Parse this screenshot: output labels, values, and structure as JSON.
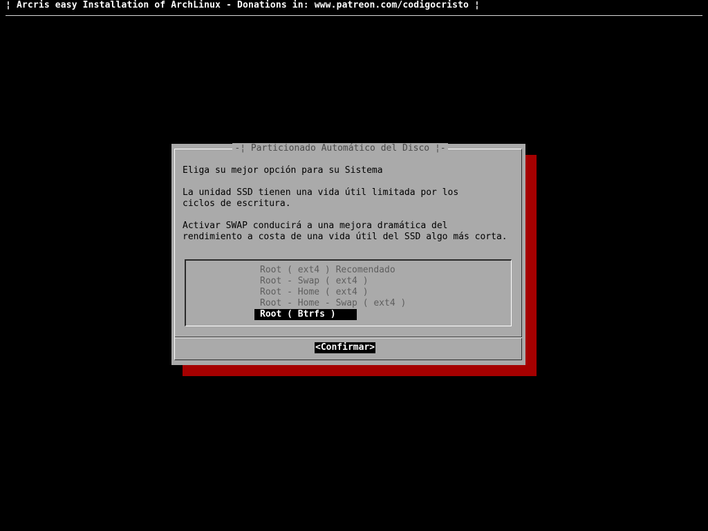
{
  "backtitle": "¦ Arcris easy Installation of ArchLinux - Donations in: www.patreon.com/codigocristo ¦",
  "dialog": {
    "title": "-¦ Particionado Automático del Disco ¦-",
    "line1": "Eliga su mejor opción para su Sistema",
    "para2_line1": "La unidad SSD tienen una vida útil limitada por los",
    "para2_line2": "ciclos de escritura.",
    "para3_line1": "Activar SWAP conducirá a una mejora dramática del",
    "para3_line2": "rendimiento a costa de una vida útil del SSD algo más corta.",
    "menu": [
      {
        "label": "Root ( ext4 ) Recomendado"
      },
      {
        "label": "Root - Swap ( ext4 )"
      },
      {
        "label": "Root - Home ( ext4 )"
      },
      {
        "label": "Root - Home - Swap ( ext4 )"
      },
      {
        "label": "Root ( Btrfs )",
        "selected": true
      }
    ],
    "confirm_button": "<Confirmar>"
  },
  "colors": {
    "screen_background": "#000000",
    "dialog_background": "#aaaaaa",
    "dialog_shadow": "#a50000",
    "highlight_background": "#000000",
    "highlight_text": "#ffffff"
  }
}
